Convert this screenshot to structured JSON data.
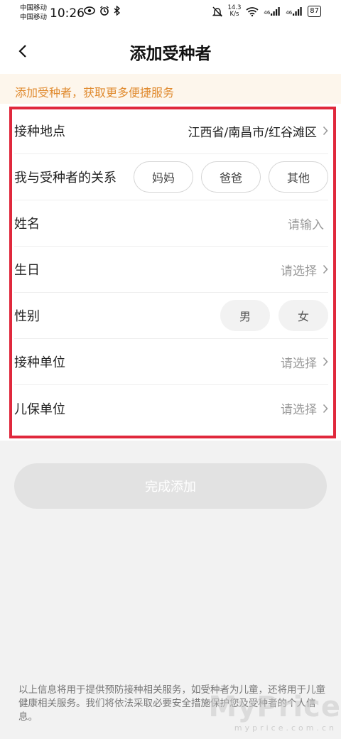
{
  "status_bar": {
    "carrier_1": "中国移动",
    "carrier_2": "中国移动",
    "time": "10:26",
    "net_speed_value": "14.3",
    "net_speed_unit": "K/s",
    "signal_1": "46",
    "signal_2": "46",
    "battery": "87"
  },
  "nav": {
    "title": "添加受种者"
  },
  "notice": {
    "text": "添加受种者，获取更多便捷服务"
  },
  "form": {
    "location": {
      "label": "接种地点",
      "value": "江西省/南昌市/红谷滩区"
    },
    "relation": {
      "label": "我与受种者的关系",
      "options": [
        "妈妈",
        "爸爸",
        "其他"
      ]
    },
    "name": {
      "label": "姓名",
      "placeholder": "请输入"
    },
    "birthday": {
      "label": "生日",
      "placeholder": "请选择"
    },
    "gender": {
      "label": "性别",
      "options": [
        "男",
        "女"
      ]
    },
    "vaccination_unit": {
      "label": "接种单位",
      "placeholder": "请选择"
    },
    "child_care_unit": {
      "label": "儿保单位",
      "placeholder": "请选择"
    }
  },
  "submit": {
    "label": "完成添加"
  },
  "footer": {
    "note": "以上信息将用于提供预防接种相关服务，如受种者为儿童，还将用于儿童健康相关服务。我们将依法采取必要安全措施保护您及受种者的个人信息。"
  },
  "watermark": {
    "text": "MyPrice",
    "domain": "myprice.com.cn"
  },
  "colors": {
    "accent_orange": "#e08a2e",
    "notice_bg": "#fdf6ec",
    "highlight_red": "#e0283c",
    "disabled_button": "#e2e2e2"
  }
}
